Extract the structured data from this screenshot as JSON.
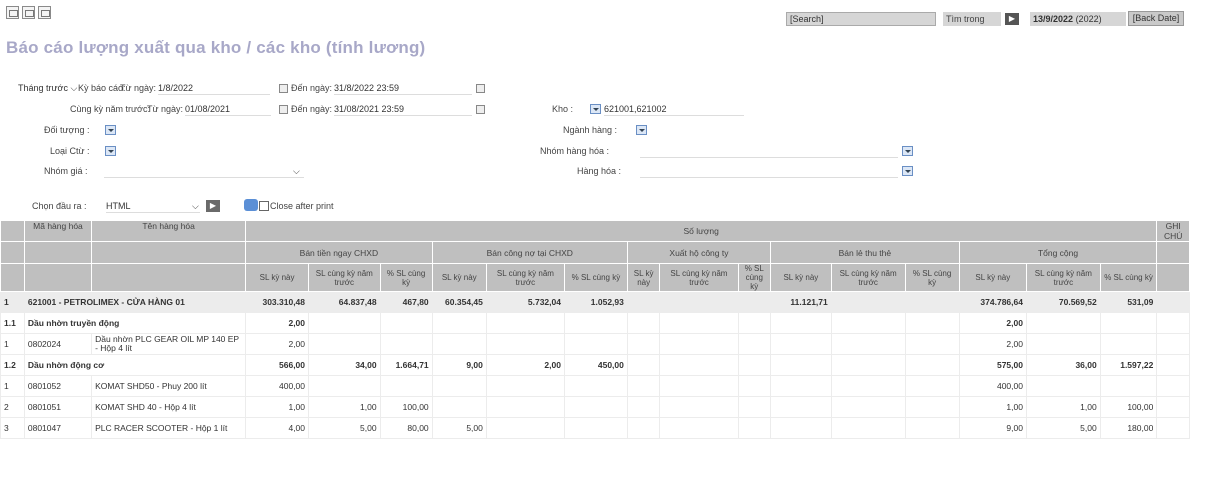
{
  "toolbar": {
    "search_text": "[Search]",
    "search_in_label": "Tìm trong",
    "go_button": "▶",
    "date_value": "13/9/2022",
    "year_value": "(2022)",
    "back_date_label": "[Back Date]"
  },
  "page": {
    "title": "Báo cáo lượng xuất qua kho / các kho (tính lương)"
  },
  "filters": {
    "period_option": "Tháng trước",
    "report_period_label": "Kỳ báo cáo:",
    "from_label": "Từ ngày:",
    "from_value": "1/8/2022",
    "to_label": "Đến ngày:",
    "to_value": "31/8/2022 23:59",
    "same_period_label": "Cùng kỳ năm trước:",
    "same_from_label": "Từ ngày:",
    "same_from_value": "01/08/2021",
    "same_to_label": "Đến ngày:",
    "same_to_value": "31/08/2021 23:59",
    "kho_label": "Kho :",
    "kho_value": "621001,621002",
    "doi_tuong_label": "Đối tượng :",
    "nganh_hang_label": "Ngành hàng :",
    "loai_ctu_label": "Loại Ctừ :",
    "nhom_hang_label": "Nhóm hàng hóa :",
    "nhom_gia_label": "Nhóm giá :",
    "hang_hoa_label": "Hàng hóa :",
    "output_label": "Chọn đầu ra :",
    "output_value": "HTML",
    "close_after_print": "Close after print"
  },
  "table": {
    "h_code": "Mã hàng hóa",
    "h_name": "Tên hàng hóa",
    "h_qty": "Số lượng",
    "h_note": "GHI CHÚ",
    "groups": [
      "Bán tiền ngay CHXD",
      "Bán công nợ tại CHXD",
      "Xuất hộ công ty",
      "Bán lẻ thu thẻ",
      "Tổng cộng"
    ],
    "sub3": [
      "SL kỳ này",
      "SL cùng kỳ năm trước",
      "% SL cùng kỳ"
    ],
    "rows": [
      {
        "type": "grp",
        "no": "1",
        "name": "621001 - PETROLIMEX - CỬA HÀNG 01",
        "v": [
          "303.310,48",
          "64.837,48",
          "467,80",
          "60.354,45",
          "5.732,04",
          "1.052,93",
          "",
          "",
          "",
          "11.121,71",
          "",
          "",
          "374.786,64",
          "70.569,52",
          "531,09"
        ]
      },
      {
        "type": "sub",
        "no": "1.1",
        "name": "Dầu nhờn truyền động",
        "v": [
          "2,00",
          "",
          "",
          "",
          "",
          "",
          "",
          "",
          "",
          "",
          "",
          "",
          "2,00",
          "",
          ""
        ]
      },
      {
        "type": "item",
        "no": "1",
        "code": "0802024",
        "name": "Dầu nhờn PLC GEAR OIL MP 140 EP - Hộp 4 lít",
        "v": [
          "2,00",
          "",
          "",
          "",
          "",
          "",
          "",
          "",
          "",
          "",
          "",
          "",
          "2,00",
          "",
          ""
        ]
      },
      {
        "type": "sub",
        "no": "1.2",
        "name": "Dầu nhờn động cơ",
        "v": [
          "566,00",
          "34,00",
          "1.664,71",
          "9,00",
          "2,00",
          "450,00",
          "",
          "",
          "",
          "",
          "",
          "",
          "575,00",
          "36,00",
          "1.597,22"
        ]
      },
      {
        "type": "item",
        "no": "1",
        "code": "0801052",
        "name": "KOMAT SHD50 - Phuy 200 lít",
        "v": [
          "400,00",
          "",
          "",
          "",
          "",
          "",
          "",
          "",
          "",
          "",
          "",
          "",
          "400,00",
          "",
          ""
        ]
      },
      {
        "type": "item",
        "no": "2",
        "code": "0801051",
        "name": "KOMAT SHD 40 - Hộp 4 lít",
        "v": [
          "1,00",
          "1,00",
          "100,00",
          "",
          "",
          "",
          "",
          "",
          "",
          "",
          "",
          "",
          "1,00",
          "1,00",
          "100,00"
        ]
      },
      {
        "type": "item",
        "no": "3",
        "code": "0801047",
        "name": "PLC RACER SCOOTER - Hộp 1 lít",
        "v": [
          "4,00",
          "5,00",
          "80,00",
          "5,00",
          "",
          "",
          "",
          "",
          "",
          "",
          "",
          "",
          "9,00",
          "5,00",
          "180,00"
        ]
      }
    ]
  }
}
